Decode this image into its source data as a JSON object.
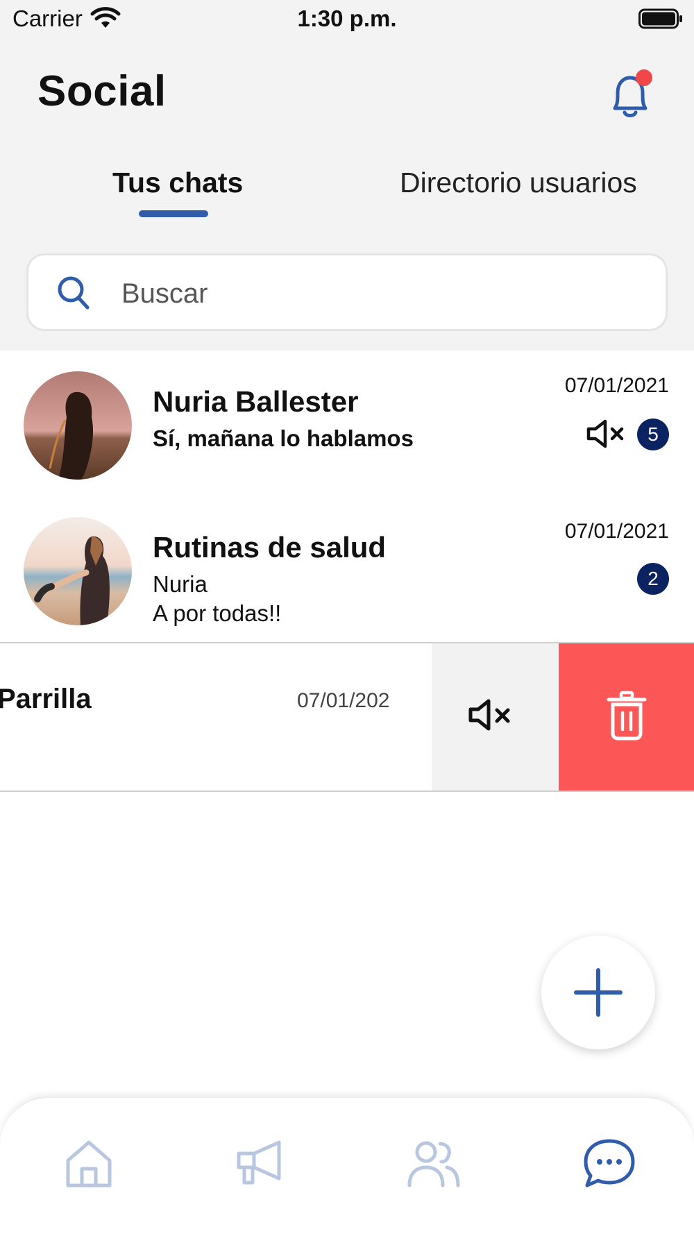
{
  "status_bar": {
    "carrier": "Carrier",
    "time": "1:30 p.m."
  },
  "header": {
    "title": "Social",
    "bell_has_notification": true
  },
  "tabs": [
    {
      "label": "Tus chats",
      "active": true
    },
    {
      "label": "Directorio usuarios",
      "active": false
    }
  ],
  "search": {
    "placeholder": "Buscar",
    "value": ""
  },
  "chats": [
    {
      "name": "Nuria Ballester",
      "message": "Sí, mañana lo hablamos",
      "date": "07/01/2021",
      "muted": true,
      "unread": "5"
    },
    {
      "name": "Rutinas de salud",
      "sender": "Nuria",
      "message": "A por todas!!",
      "date": "07/01/2021",
      "muted": false,
      "unread": "2"
    },
    {
      "name": "Parrilla",
      "date": "07/01/202",
      "swiped": true
    }
  ],
  "swipe_actions": {
    "mute": "mute-icon",
    "delete": "trash-icon"
  },
  "bottom_nav": [
    "home-icon",
    "megaphone-icon",
    "users-icon",
    "chat-icon"
  ],
  "colors": {
    "accent": "#2f5cab",
    "badge": "#0b2361",
    "delete": "#fc5656",
    "notification_dot": "#f0474a",
    "nav_inactive": "#b9c6df"
  }
}
